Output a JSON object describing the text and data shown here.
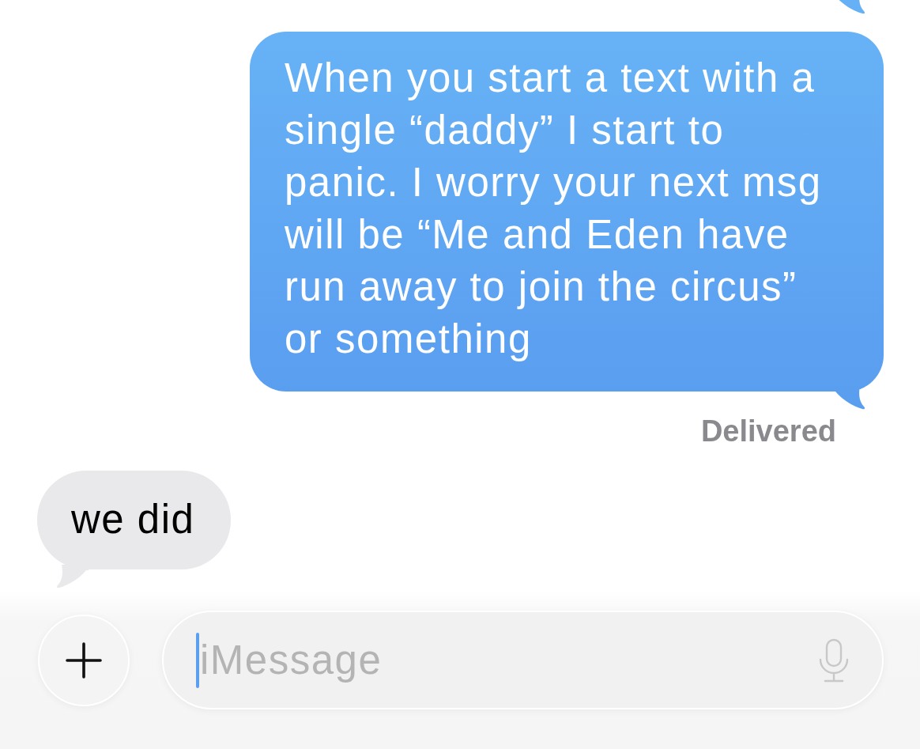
{
  "messages": [
    {
      "kind": "sent",
      "text": "When you start a text with a single “daddy” I start to panic. I worry your next msg will be “Me and Eden have run away to join the circus” or something",
      "status": "Delivered"
    },
    {
      "kind": "received",
      "text": "we did"
    }
  ],
  "composer": {
    "focused": true,
    "placeholder": "iMessage"
  }
}
